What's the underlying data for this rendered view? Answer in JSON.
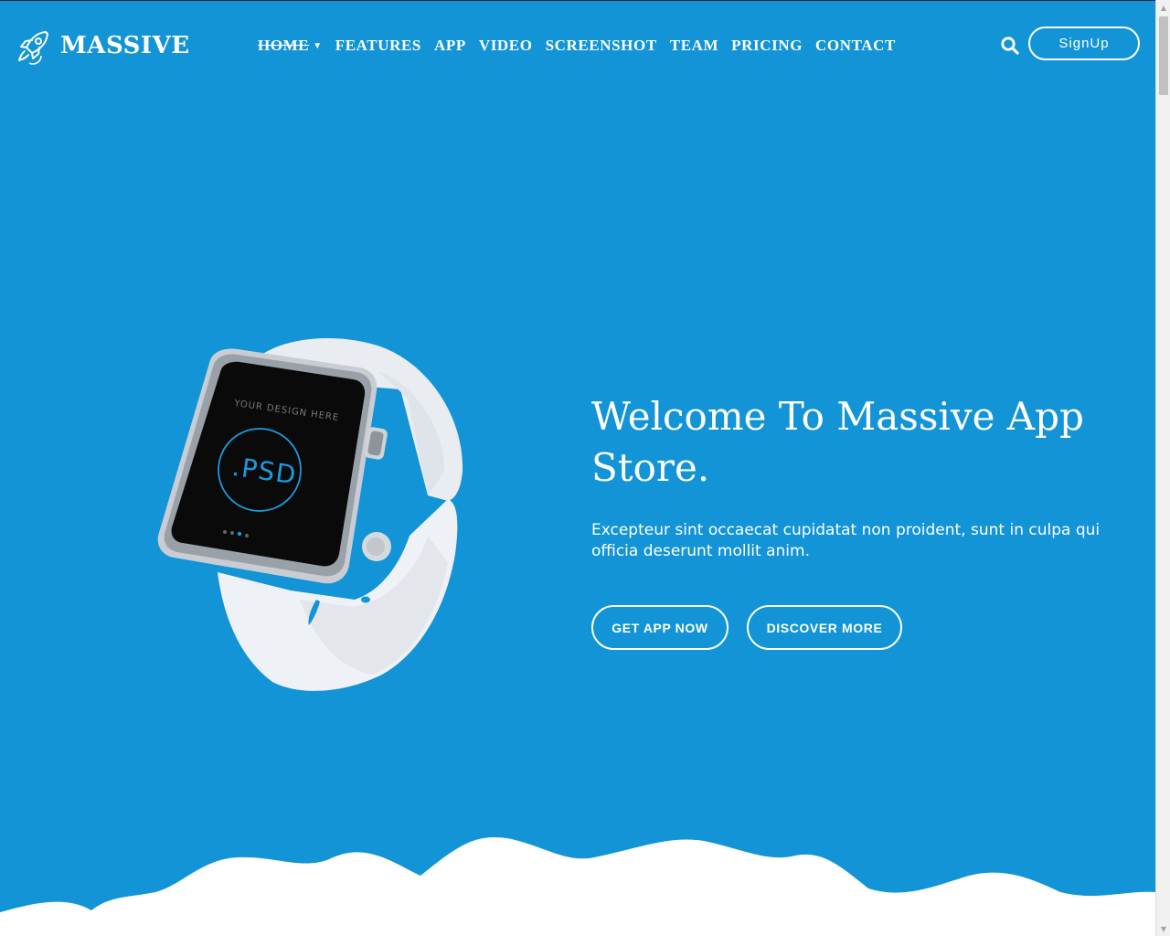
{
  "brand": {
    "name": "MASSIVE",
    "logo_icon": "rocket-icon"
  },
  "nav": {
    "items": [
      "HOME",
      "FEATURES",
      "APP",
      "VIDEO",
      "SCREENSHOT",
      "TEAM",
      "PRICING",
      "CONTACT"
    ],
    "dropdown_icon": "caret-down-icon"
  },
  "header": {
    "search_icon": "search-icon",
    "signup_label": "SignUp"
  },
  "hero": {
    "title": "Welcome To Massive App Store.",
    "description": "Excepteur sint occaecat cupidatat non proident, sunt in culpa qui officia deserunt mollit anim.",
    "primary_button": "GET APP NOW",
    "secondary_button": "DISCOVER MORE",
    "watch_screen": {
      "caption": "YOUR DESIGN HERE",
      "label": ".PSD"
    }
  },
  "colors": {
    "background": "#1294d6",
    "text": "#ffffff",
    "wave": "#ffffff",
    "screen": "#0a0a0a",
    "accent": "#1a9be0"
  }
}
